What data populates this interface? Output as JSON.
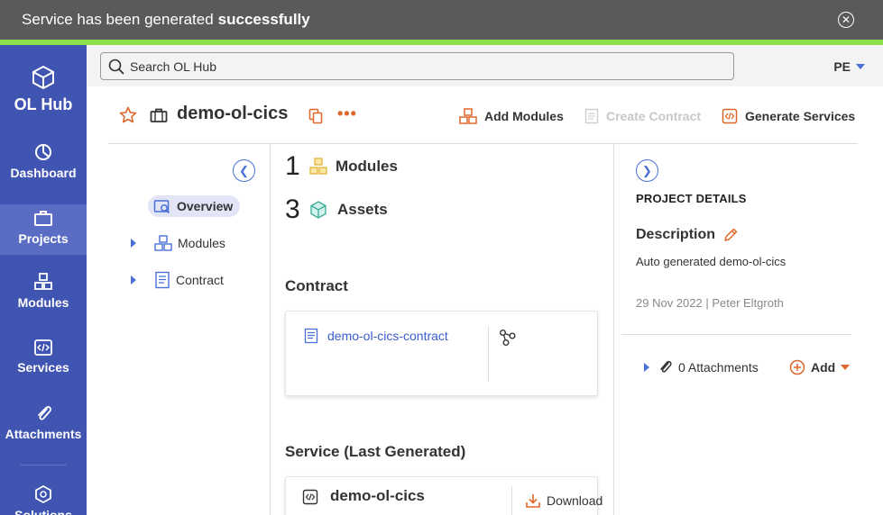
{
  "toast": {
    "message": "Service has been generated",
    "message_bold": "successfully"
  },
  "app": {
    "name": "OL Hub"
  },
  "sidebar": {
    "items": [
      {
        "label": "Dashboard",
        "icon": "dashboard-icon"
      },
      {
        "label": "Projects",
        "icon": "projects-icon",
        "active": true
      },
      {
        "label": "Modules",
        "icon": "modules-icon"
      },
      {
        "label": "Services",
        "icon": "services-icon"
      },
      {
        "label": "Attachments",
        "icon": "attachments-icon"
      },
      {
        "label": "Solutions",
        "icon": "solutions-icon"
      }
    ]
  },
  "search": {
    "placeholder": "Search OL Hub"
  },
  "user": {
    "initials": "PE"
  },
  "project": {
    "title": "demo-ol-cics",
    "actions": {
      "add_modules": "Add Modules",
      "create_contract": "Create Contract",
      "generate_services": "Generate Services"
    }
  },
  "tree": {
    "items": [
      {
        "label": "Overview"
      },
      {
        "label": "Modules"
      },
      {
        "label": "Contract"
      }
    ]
  },
  "counts": [
    {
      "num": "1",
      "label": "Modules"
    },
    {
      "num": "3",
      "label": "Assets"
    }
  ],
  "contract": {
    "section_title": "Contract",
    "name": "demo-ol-cics-contract"
  },
  "service": {
    "section_title": "Service (Last Generated)",
    "name": "demo-ol-cics",
    "download_label": "Download"
  },
  "details": {
    "title": "PROJECT DETAILS",
    "description_label": "Description",
    "description": "Auto generated demo-ol-cics",
    "meta": "29 Nov 2022 | Peter Eltgroth",
    "attachments": "0 Attachments",
    "add_label": "Add"
  },
  "colors": {
    "sidebar": "#4054b2",
    "accent_orange": "#e0672b",
    "link_blue": "#3b5ccc",
    "success_green": "#8ee04c"
  }
}
